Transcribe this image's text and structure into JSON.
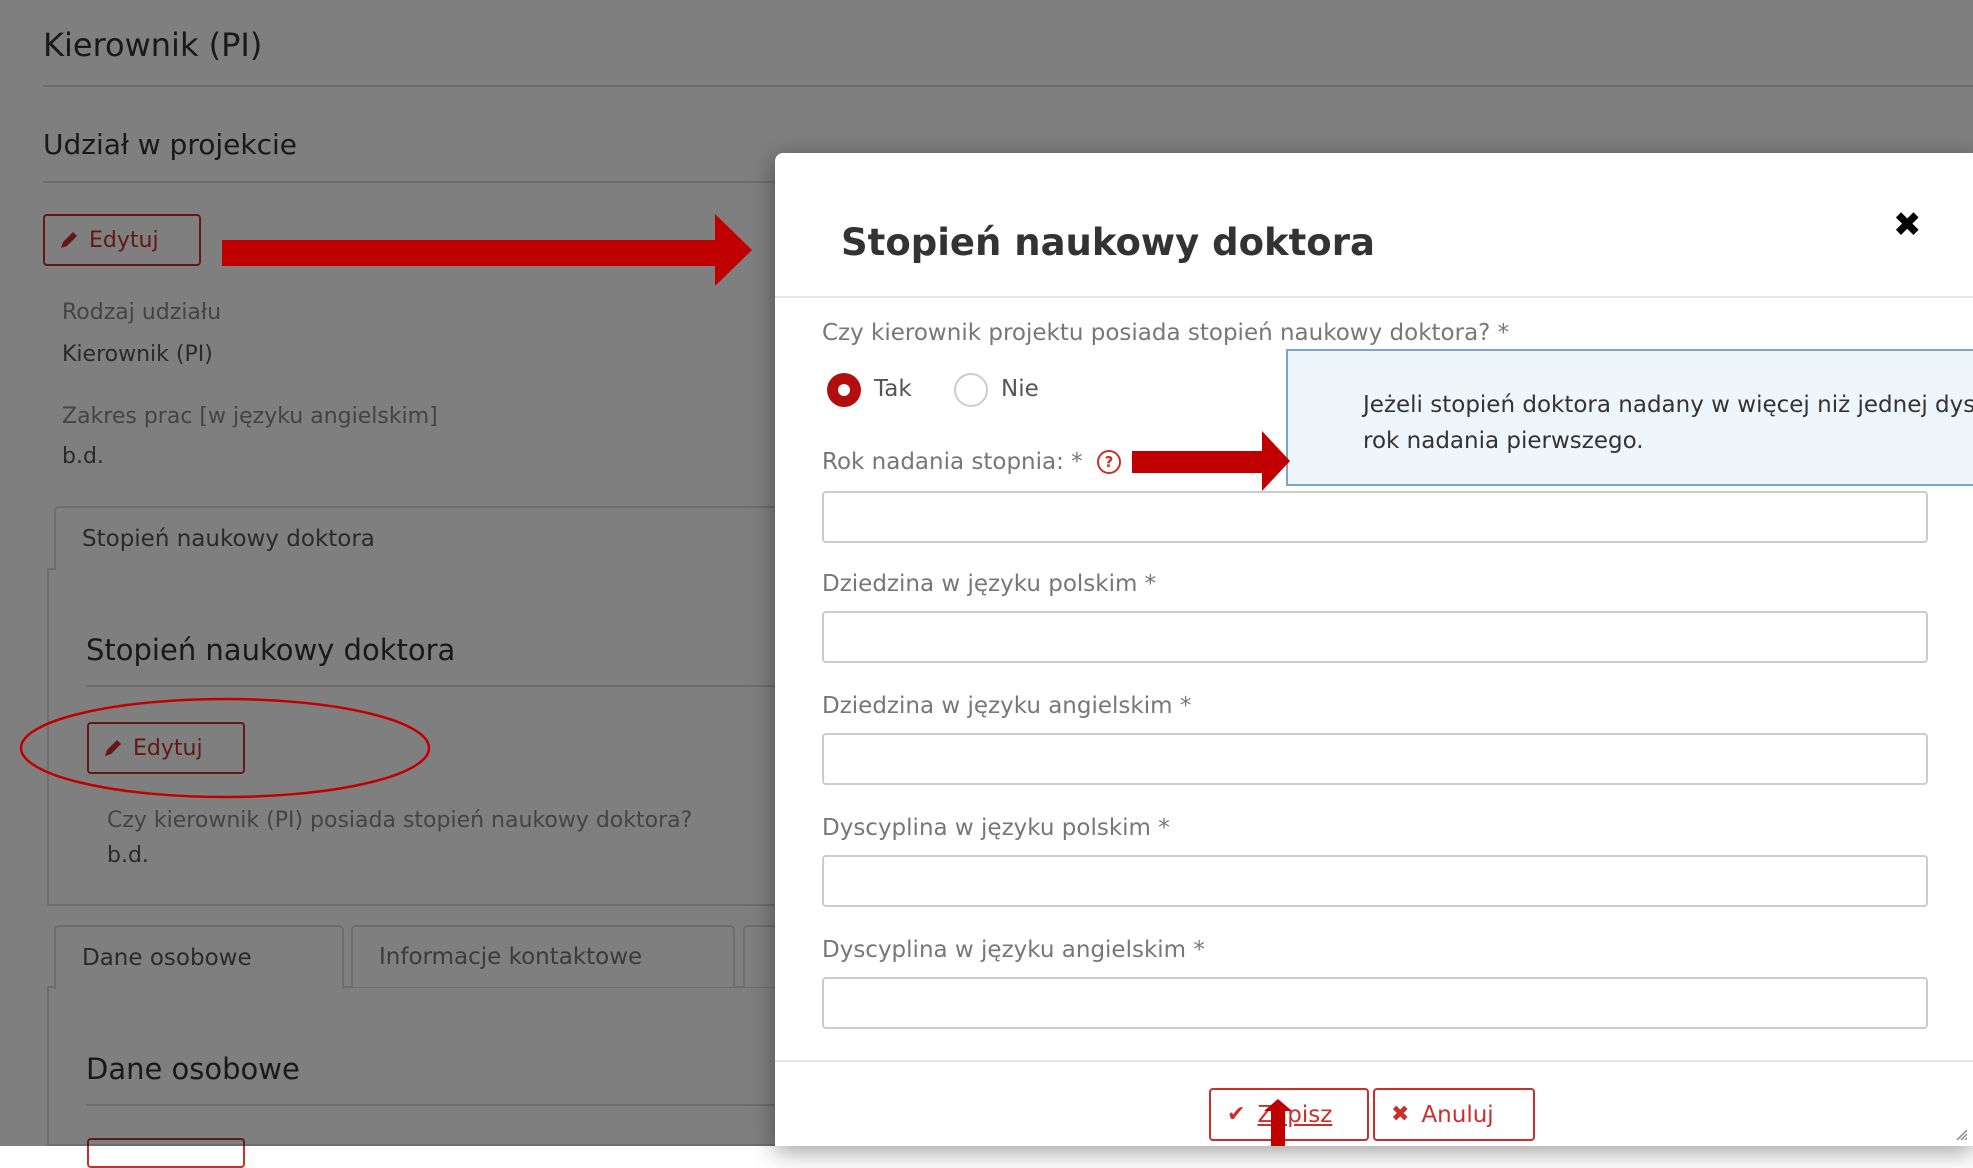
{
  "page": {
    "section_title": "Kierownik (PI)",
    "subsection_title": "Udział w projekcie",
    "edit_label": "Edytuj",
    "participation_type_label": "Rodzaj udziału",
    "participation_type_value": "Kierownik (PI)",
    "work_scope_label": "Zakres prac [w języku angielskim]",
    "work_scope_value": "b.d.",
    "phd_tab_label": "Stopień naukowy doktora",
    "phd_section_title": "Stopień naukowy doktora",
    "phd_edit_label": "Edytuj",
    "phd_question": "Czy kierownik (PI) posiada stopień naukowy doktora?",
    "phd_value": "b.d.",
    "tabs": [
      {
        "label": "Dane osobowe"
      },
      {
        "label": "Informacje kontaktowe"
      }
    ],
    "personal_section_title": "Dane osobowe"
  },
  "modal": {
    "title": "Stopień naukowy doktora",
    "close_glyph": "✖",
    "question_label": "Czy kierownik projektu posiada stopień naukowy doktora? *",
    "radio_yes": "Tak",
    "radio_no": "Nie",
    "selected": "Tak",
    "year_label": "Rok nadania stopnia: *",
    "help_glyph": "?",
    "tooltip_line1": "Jeżeli stopień doktora nadany w więcej niż jednej dys",
    "tooltip_line2": "rok nadania pierwszego.",
    "fields": [
      {
        "label": "Dziedzina w języku polskim *",
        "value": ""
      },
      {
        "label": "Dziedzina w języku angielskim *",
        "value": ""
      },
      {
        "label": "Dyscyplina w języku polskim *",
        "value": ""
      },
      {
        "label": "Dyscyplina w języku angielskim *",
        "value": ""
      }
    ],
    "year_value": "",
    "save_glyph": "✔",
    "save_label": "Zapisz",
    "cancel_glyph": "✖",
    "cancel_label": "Anuluj"
  },
  "colors": {
    "accent": "#c9302c",
    "radio_selected": "#b20e0e",
    "annotation": "#c00000",
    "tooltip_bg": "#eef5fb"
  }
}
